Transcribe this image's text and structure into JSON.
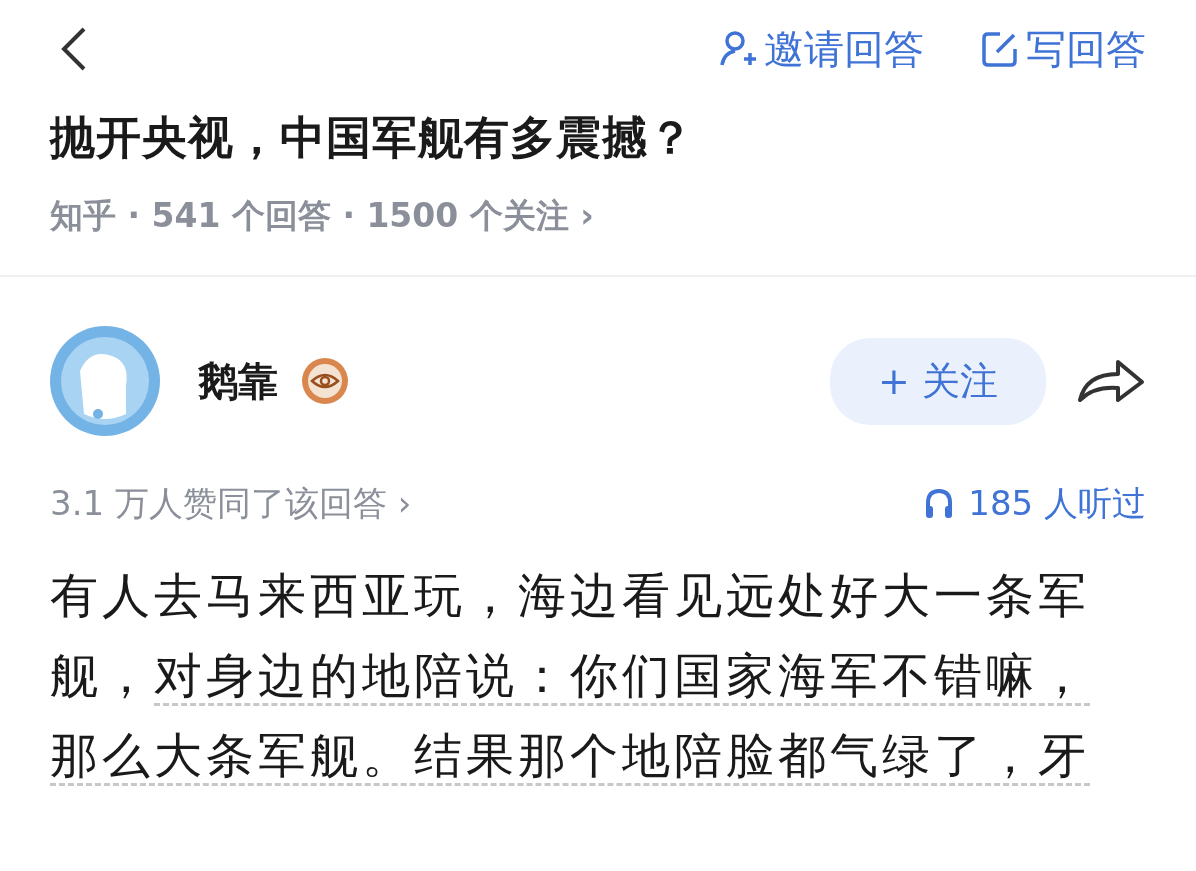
{
  "top_bar": {
    "actions": [
      {
        "kind": "invite",
        "label": "邀请回答"
      },
      {
        "kind": "write",
        "label": "写回答"
      }
    ]
  },
  "question": {
    "title": "抛开央视，中国军舰有多震撼？",
    "meta": "知乎 · 541 个回答 · 1500 个关注 ›"
  },
  "author": {
    "name": "鹅靠",
    "follow_button": "+ 关注"
  },
  "stats": {
    "likes": "3.1 万人赞同了该回答 ›",
    "listens": "185 人听过"
  },
  "answer": {
    "segments": [
      {
        "text": "有人去马来西亚玩，海边看见远处好大一条军舰，",
        "underlined": false
      },
      {
        "text": "对身边的地陪说：你们国家海军不错嘛，那么大条军舰。结果那个地陪脸都气绿了，牙",
        "underlined": true
      }
    ]
  }
}
